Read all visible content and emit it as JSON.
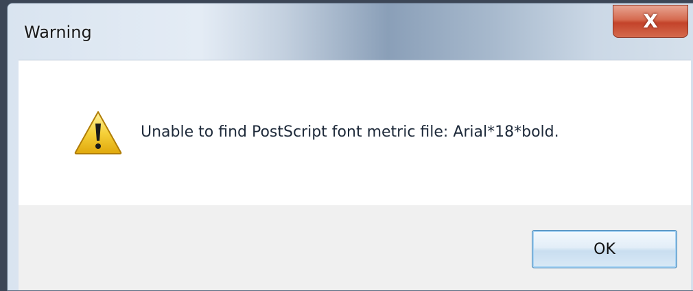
{
  "dialog": {
    "title": "Warning",
    "close_label": "X",
    "message": "Unable to find PostScript font metric file: Arial*18*bold.",
    "ok_label": "OK",
    "icon": "warning-icon"
  },
  "colors": {
    "content_bg": "#ffffff",
    "footer_bg": "#f0f0f0",
    "close_red": "#c3432a",
    "button_border": "#3c7fb1"
  }
}
